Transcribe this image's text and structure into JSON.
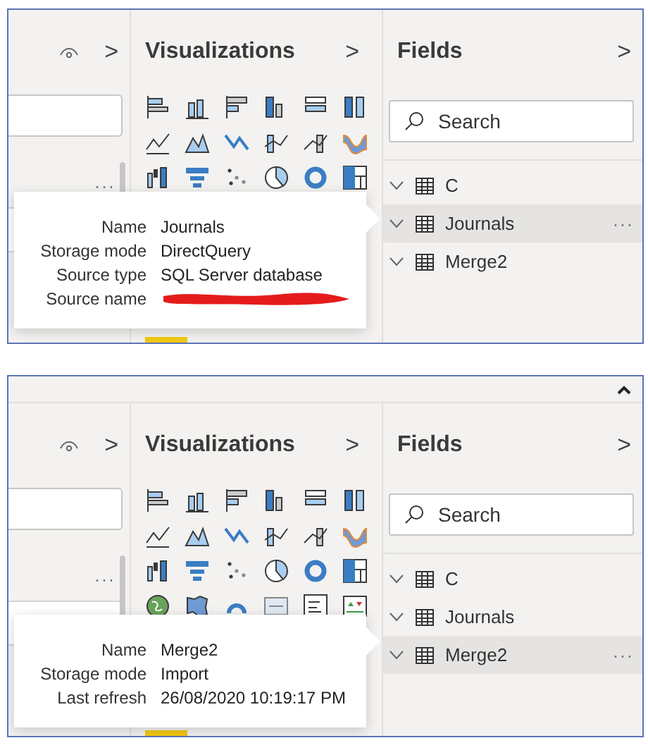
{
  "panels": [
    {
      "collapse_bar": false,
      "left_pane": {
        "more": "···"
      },
      "visualizations": {
        "title": "Visualizations",
        "expand": ">"
      },
      "fields": {
        "title": "Fields",
        "expand": ">",
        "search": {
          "placeholder": "Search"
        },
        "tables": [
          {
            "name": "C",
            "selected": false
          },
          {
            "name": "Journals",
            "selected": true,
            "more": "···"
          },
          {
            "name": "Merge2",
            "selected": false
          }
        ]
      },
      "tooltip": {
        "rows": [
          {
            "label": "Name",
            "kind": "text",
            "value": "Journals"
          },
          {
            "label": "Storage mode",
            "kind": "text",
            "value": "DirectQuery"
          },
          {
            "label": "Source type",
            "kind": "text",
            "value": "SQL Server database"
          },
          {
            "label": "Source name",
            "kind": "redacted"
          }
        ]
      }
    },
    {
      "collapse_bar": true,
      "left_pane": {
        "more": "···"
      },
      "visualizations": {
        "title": "Visualizations",
        "expand": ">"
      },
      "fields": {
        "title": "Fields",
        "expand": ">",
        "search": {
          "placeholder": "Search"
        },
        "tables": [
          {
            "name": "C",
            "selected": false
          },
          {
            "name": "Journals",
            "selected": false
          },
          {
            "name": "Merge2",
            "selected": true,
            "more": "···"
          }
        ]
      },
      "tooltip": {
        "rows": [
          {
            "label": "Name",
            "kind": "text",
            "value": "Merge2"
          },
          {
            "label": "Storage mode",
            "kind": "text",
            "value": "Import"
          },
          {
            "label": "Last refresh",
            "kind": "text",
            "value": "26/08/2020 10:19:17 PM"
          }
        ]
      }
    }
  ]
}
